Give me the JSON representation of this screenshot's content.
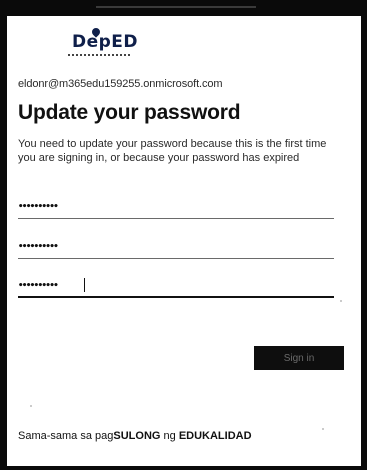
{
  "logo": {
    "text": "DepED",
    "icon": "deped-torch-logo"
  },
  "account": {
    "email": "eldonr@m365edu159255.onmicrosoft.com"
  },
  "page": {
    "title": "Update your password",
    "description": "You need to update your password because this is the first time you are signing in, or because your password has expired"
  },
  "form": {
    "current_password": "••••••••••",
    "new_password": "••••••••••",
    "confirm_password": "••••••••••",
    "submit_label": "Sign in"
  },
  "footer": {
    "prefix": "Sama-sama sa pag",
    "bold_1": "SULONG",
    "middle": " ng ",
    "bold_2": "EDUKALIDAD"
  },
  "colors": {
    "frame": "#0a0a0a",
    "button_bg": "#0e0e0e",
    "logo": "#0f1f4a",
    "text": "#111111"
  }
}
